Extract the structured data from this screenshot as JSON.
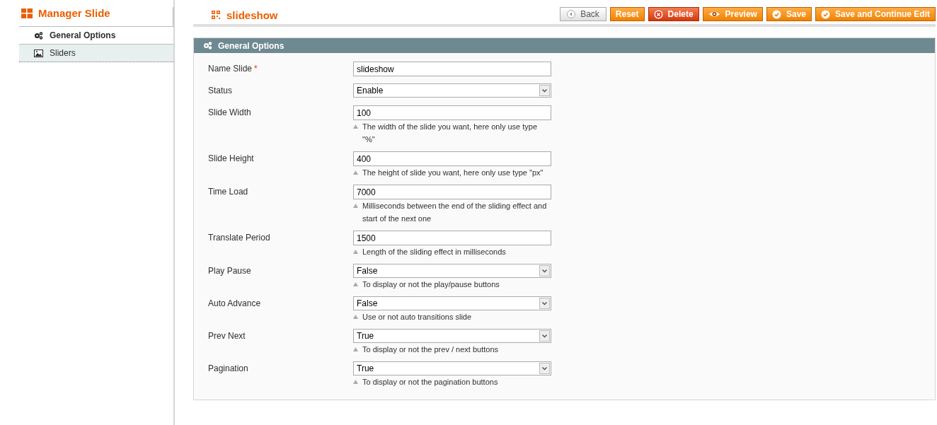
{
  "sidebar": {
    "title": "Manager Slide",
    "items": [
      {
        "label": "General Options",
        "kind": "options",
        "selected": true
      },
      {
        "label": "Sliders",
        "kind": "images",
        "selected": false
      }
    ]
  },
  "page_title": "slideshow",
  "buttons": [
    {
      "label": "Back",
      "kind": "back"
    },
    {
      "label": "Reset",
      "kind": "reset"
    },
    {
      "label": "Delete",
      "kind": "delete"
    },
    {
      "label": "Preview",
      "kind": "preview"
    },
    {
      "label": "Save",
      "kind": "save"
    },
    {
      "label": "Save and Continue Edit",
      "kind": "save"
    }
  ],
  "section": {
    "title": "General Options",
    "fields": [
      {
        "label": "Name Slide",
        "required_mark": "*",
        "kind": "text",
        "value": "slideshow"
      },
      {
        "label": "Status",
        "kind": "select",
        "value": "Enable"
      },
      {
        "label": "Slide Width",
        "kind": "text",
        "value": "100",
        "note": "The width of the slide you want, here only use type \"%\""
      },
      {
        "label": "Slide Height",
        "kind": "text",
        "value": "400",
        "note": "The height of slide you want, here only use type \"px\""
      },
      {
        "label": "Time Load",
        "kind": "text",
        "value": "7000",
        "note": "Milliseconds between the end of the sliding effect and start of the next one"
      },
      {
        "label": "Translate Period",
        "kind": "text",
        "value": "1500",
        "note": "Length of the sliding effect in milliseconds"
      },
      {
        "label": "Play Pause",
        "kind": "select",
        "value": "False",
        "note": "To display or not the play/pause buttons"
      },
      {
        "label": "Auto Advance",
        "kind": "select",
        "value": "False",
        "note": "Use or not auto transitions slide"
      },
      {
        "label": "Prev Next",
        "kind": "select",
        "value": "True",
        "note": "To display or not the prev / next buttons"
      },
      {
        "label": "Pagination",
        "kind": "select",
        "value": "True",
        "note": "To display or not the pagination buttons"
      }
    ]
  }
}
